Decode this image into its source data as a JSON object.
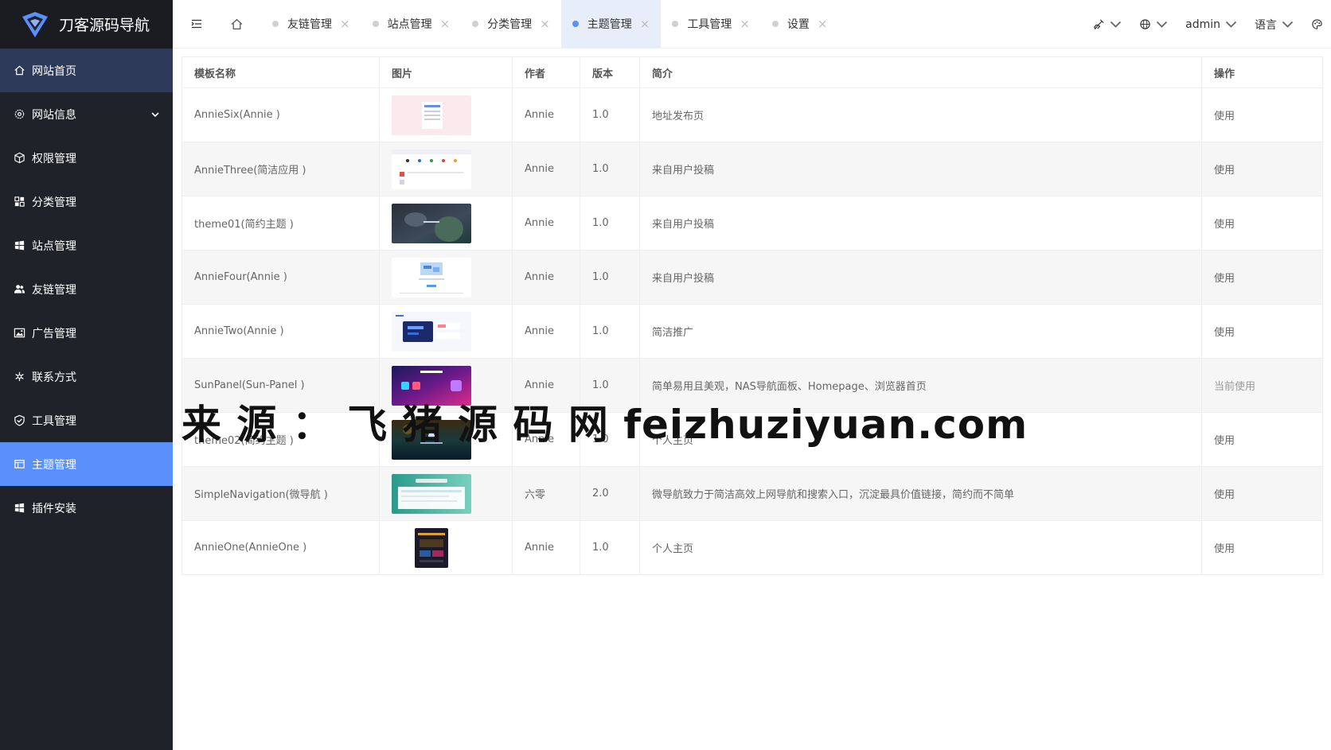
{
  "app": {
    "title": "刀客源码导航"
  },
  "sidebar": {
    "items": [
      {
        "label": "网站首页",
        "icon": "home-icon"
      },
      {
        "label": "网站信息",
        "icon": "gear-icon"
      },
      {
        "label": "权限管理",
        "icon": "cube-icon"
      },
      {
        "label": "分类管理",
        "icon": "apps-icon"
      },
      {
        "label": "站点管理",
        "icon": "windows-icon"
      },
      {
        "label": "友链管理",
        "icon": "users-icon"
      },
      {
        "label": "广告管理",
        "icon": "image-icon"
      },
      {
        "label": "联系方式",
        "icon": "asterisk-icon"
      },
      {
        "label": "工具管理",
        "icon": "shield-check-icon"
      },
      {
        "label": "主题管理",
        "icon": "layout-icon"
      },
      {
        "label": "插件安装",
        "icon": "windows-icon"
      }
    ]
  },
  "tabs": [
    {
      "label": "友链管理"
    },
    {
      "label": "站点管理"
    },
    {
      "label": "分类管理"
    },
    {
      "label": "主题管理"
    },
    {
      "label": "工具管理"
    },
    {
      "label": "设置"
    }
  ],
  "topright": {
    "user": "admin",
    "language": "语言"
  },
  "table": {
    "headers": [
      "模板名称",
      "图片",
      "作者",
      "版本",
      "简介",
      "操作"
    ],
    "rows": [
      {
        "name": "AnnieSix(Annie )",
        "author": "Annie",
        "version": "1.0",
        "desc": "地址发布页",
        "action": "使用"
      },
      {
        "name": "AnnieThree(简洁应用 )",
        "author": "Annie",
        "version": "1.0",
        "desc": "来自用户投稿",
        "action": "使用"
      },
      {
        "name": "theme01(简约主题 )",
        "author": "Annie",
        "version": "1.0",
        "desc": "来自用户投稿",
        "action": "使用"
      },
      {
        "name": "AnnieFour(Annie )",
        "author": "Annie",
        "version": "1.0",
        "desc": "来自用户投稿",
        "action": "使用"
      },
      {
        "name": "AnnieTwo(Annie )",
        "author": "Annie",
        "version": "1.0",
        "desc": "简洁推广",
        "action": "使用"
      },
      {
        "name": "SunPanel(Sun-Panel )",
        "author": "Annie",
        "version": "1.0",
        "desc": "简单易用且美观，NAS导航面板、Homepage、浏览器首页",
        "action": "当前使用"
      },
      {
        "name": "theme02(简约主题 )",
        "author": "Annie",
        "version": "1.0",
        "desc": "个人主页",
        "action": "使用"
      },
      {
        "name": "SimpleNavigation(微导航 )",
        "author": "六零",
        "version": "2.0",
        "desc": "微导航致力于简洁高效上网导航和搜索入口，沉淀最具价值链接，简约而不简单",
        "action": "使用"
      },
      {
        "name": "AnnieOne(AnnieOne )",
        "author": "Annie",
        "version": "1.0",
        "desc": "个人主页",
        "action": "使用"
      }
    ]
  },
  "watermark": "来 源 ： 飞 猪 源 码 网 feizhuziyuan.com",
  "colors": {
    "sidebar_bg": "#20222a",
    "active": "#5b8ff9",
    "home_bg": "#2d3a5a"
  }
}
